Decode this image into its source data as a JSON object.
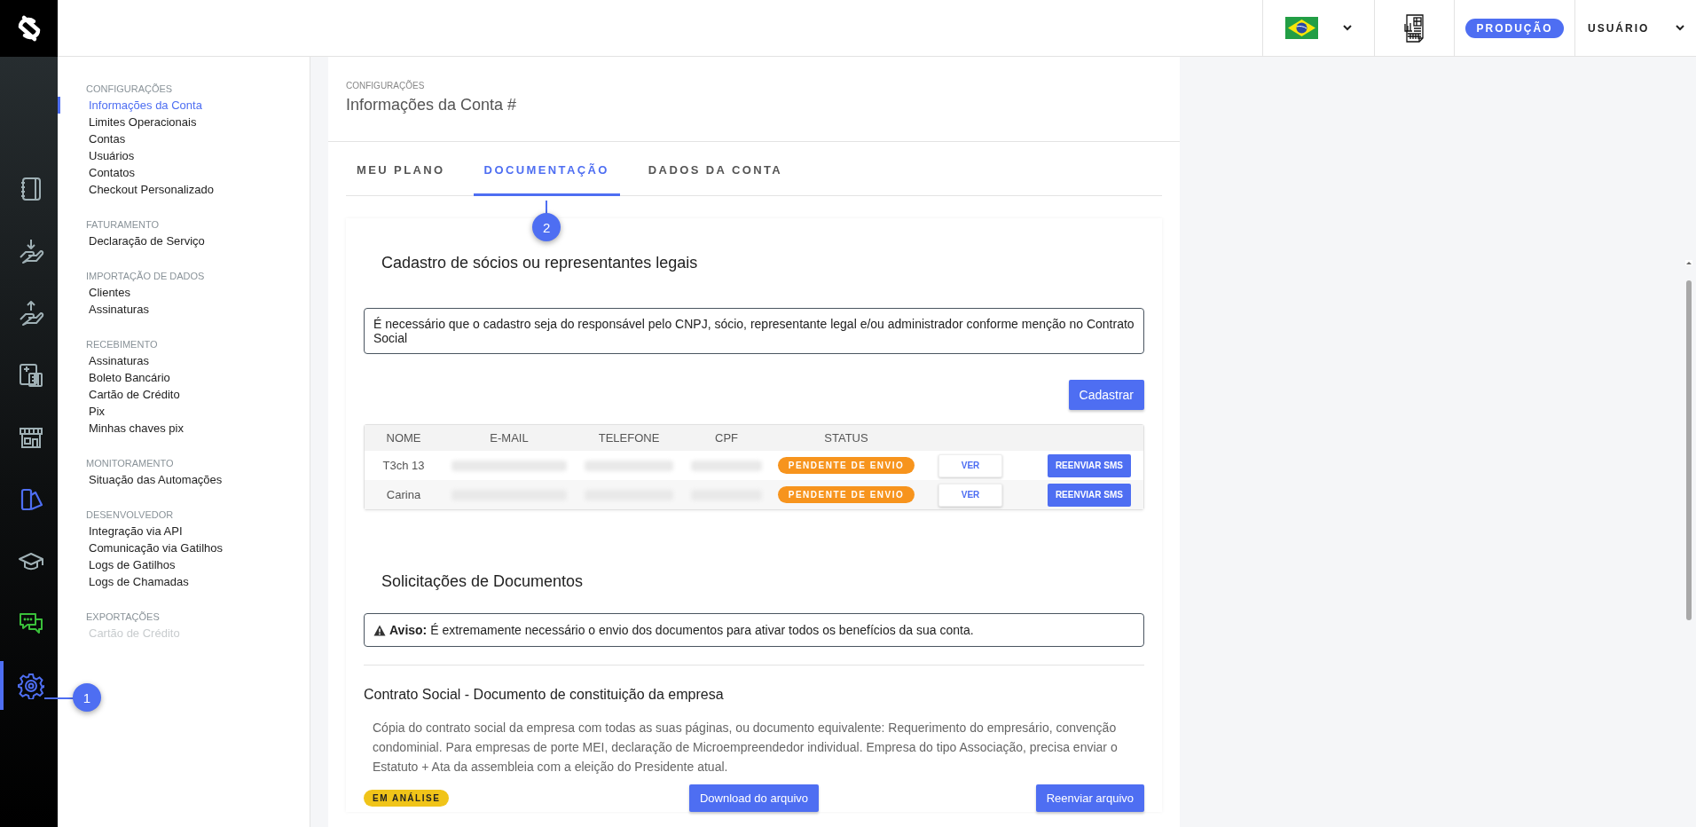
{
  "header": {
    "environment_badge": "PRODUÇÃO",
    "user_menu": "USUÁRIO"
  },
  "rail": [
    {
      "kind": "notebook",
      "selected": false
    },
    {
      "kind": "receive",
      "selected": false
    },
    {
      "kind": "send",
      "selected": false
    },
    {
      "kind": "calculator",
      "selected": false
    },
    {
      "kind": "store",
      "selected": false
    },
    {
      "kind": "swatch",
      "selected": false
    },
    {
      "kind": "cap",
      "selected": false
    },
    {
      "kind": "chat",
      "selected": false
    },
    {
      "kind": "gear",
      "selected": true,
      "callout": "1"
    }
  ],
  "sidebar": [
    {
      "heading": "CONFIGURAÇÕES",
      "items": [
        {
          "label": "Informações da Conta",
          "selected": true,
          "disabled": false
        },
        {
          "label": "Limites Operacionais",
          "selected": false,
          "disabled": false
        },
        {
          "label": "Contas",
          "selected": false,
          "disabled": false
        },
        {
          "label": "Usuários",
          "selected": false,
          "disabled": false
        },
        {
          "label": "Contatos",
          "selected": false,
          "disabled": false
        },
        {
          "label": "Checkout Personalizado",
          "selected": false,
          "disabled": false
        }
      ]
    },
    {
      "heading": "FATURAMENTO",
      "items": [
        {
          "label": "Declaração de Serviço",
          "selected": false,
          "disabled": false
        }
      ]
    },
    {
      "heading": "IMPORTAÇÃO DE DADOS",
      "items": [
        {
          "label": "Clientes",
          "selected": false,
          "disabled": false
        },
        {
          "label": "Assinaturas",
          "selected": false,
          "disabled": false
        }
      ]
    },
    {
      "heading": "RECEBIMENTO",
      "items": [
        {
          "label": "Assinaturas",
          "selected": false,
          "disabled": false
        },
        {
          "label": "Boleto Bancário",
          "selected": false,
          "disabled": false
        },
        {
          "label": "Cartão de Crédito",
          "selected": false,
          "disabled": false
        },
        {
          "label": "Pix",
          "selected": false,
          "disabled": false
        },
        {
          "label": "Minhas chaves pix",
          "selected": false,
          "disabled": false
        }
      ]
    },
    {
      "heading": "MONITORAMENTO",
      "items": [
        {
          "label": "Situação das Automações",
          "selected": false,
          "disabled": false
        }
      ]
    },
    {
      "heading": "DESENVOLVEDOR",
      "items": [
        {
          "label": "Integração via API",
          "selected": false,
          "disabled": false
        },
        {
          "label": "Comunicação via Gatilhos",
          "selected": false,
          "disabled": false
        },
        {
          "label": "Logs de Gatilhos",
          "selected": false,
          "disabled": false
        },
        {
          "label": "Logs de Chamadas",
          "selected": false,
          "disabled": false
        }
      ]
    },
    {
      "heading": "EXPORTAÇÕES",
      "items": [
        {
          "label": "Cartão de Crédito",
          "selected": false,
          "disabled": true
        }
      ]
    }
  ],
  "page": {
    "breadcrumb": "CONFIGURAÇÕES",
    "title": "Informações da Conta #"
  },
  "tabs": [
    {
      "label": "MEU PLANO",
      "selected": false
    },
    {
      "label": "DOCUMENTAÇÃO",
      "selected": true,
      "callout": "2"
    },
    {
      "label": "DADOS DA CONTA",
      "selected": false
    }
  ],
  "partners": {
    "title": "Cadastro de sócios ou representantes legais",
    "notice": "É necessário que o cadastro seja do responsável pelo CNPJ, sócio, representante legal e/ou administrador conforme menção no Contrato Social",
    "register_button": "Cadastrar",
    "table": {
      "columns": [
        "NOME",
        "E-MAIL",
        "TELEFONE",
        "CPF",
        "STATUS"
      ],
      "rows": [
        {
          "name": "T3ch 13",
          "status": {
            "label": "PENDENTE DE ENVIO",
            "color": "#f7941d"
          },
          "view_button": "VER",
          "sms_button": "REENVIAR SMS"
        },
        {
          "name": "Carina",
          "status": {
            "label": "PENDENTE DE ENVIO",
            "color": "#f7941d"
          },
          "view_button": "VER",
          "sms_button": "REENVIAR SMS"
        }
      ]
    }
  },
  "documents": {
    "title": "Solicitações de Documentos",
    "warning": "**Aviso:** É extremamente necessário o envio dos documentos para ativar todos os benefícios da sua conta.",
    "items": [
      {
        "title": "Contrato Social - Documento de constituição da empresa",
        "description": "Cópia do contrato social da empresa com todas as suas páginas, ou documento equivalente: Requerimento do empresário, convenção condominial. Para empresas de porte MEI, declaração de Microempreendedor individual. Empresa do tipo Associação, precisa enviar o Estatuto + Ata da assembleia com a eleição do Presidente atual.",
        "status": {
          "label": "EM ANÁLISE",
          "color": "#f0c419"
        },
        "download_button": "Download do arquivo",
        "resend_button": "Reenviar arquivo"
      }
    ]
  }
}
